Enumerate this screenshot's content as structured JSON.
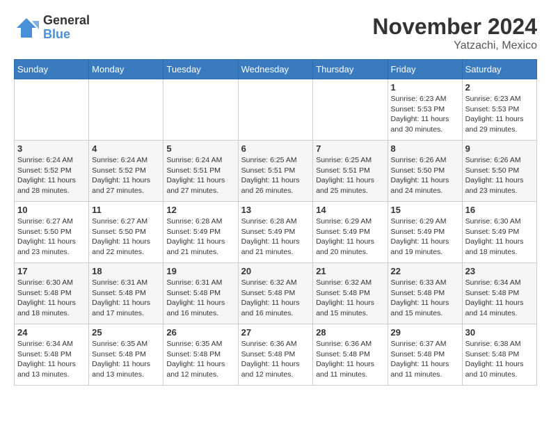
{
  "header": {
    "logo": {
      "general": "General",
      "blue": "Blue"
    },
    "month_title": "November 2024",
    "location": "Yatzachi, Mexico"
  },
  "weekdays": [
    "Sunday",
    "Monday",
    "Tuesday",
    "Wednesday",
    "Thursday",
    "Friday",
    "Saturday"
  ],
  "weeks": [
    [
      {
        "day": "",
        "info": ""
      },
      {
        "day": "",
        "info": ""
      },
      {
        "day": "",
        "info": ""
      },
      {
        "day": "",
        "info": ""
      },
      {
        "day": "",
        "info": ""
      },
      {
        "day": "1",
        "info": "Sunrise: 6:23 AM\nSunset: 5:53 PM\nDaylight: 11 hours and 30 minutes."
      },
      {
        "day": "2",
        "info": "Sunrise: 6:23 AM\nSunset: 5:53 PM\nDaylight: 11 hours and 29 minutes."
      }
    ],
    [
      {
        "day": "3",
        "info": "Sunrise: 6:24 AM\nSunset: 5:52 PM\nDaylight: 11 hours and 28 minutes."
      },
      {
        "day": "4",
        "info": "Sunrise: 6:24 AM\nSunset: 5:52 PM\nDaylight: 11 hours and 27 minutes."
      },
      {
        "day": "5",
        "info": "Sunrise: 6:24 AM\nSunset: 5:51 PM\nDaylight: 11 hours and 27 minutes."
      },
      {
        "day": "6",
        "info": "Sunrise: 6:25 AM\nSunset: 5:51 PM\nDaylight: 11 hours and 26 minutes."
      },
      {
        "day": "7",
        "info": "Sunrise: 6:25 AM\nSunset: 5:51 PM\nDaylight: 11 hours and 25 minutes."
      },
      {
        "day": "8",
        "info": "Sunrise: 6:26 AM\nSunset: 5:50 PM\nDaylight: 11 hours and 24 minutes."
      },
      {
        "day": "9",
        "info": "Sunrise: 6:26 AM\nSunset: 5:50 PM\nDaylight: 11 hours and 23 minutes."
      }
    ],
    [
      {
        "day": "10",
        "info": "Sunrise: 6:27 AM\nSunset: 5:50 PM\nDaylight: 11 hours and 23 minutes."
      },
      {
        "day": "11",
        "info": "Sunrise: 6:27 AM\nSunset: 5:50 PM\nDaylight: 11 hours and 22 minutes."
      },
      {
        "day": "12",
        "info": "Sunrise: 6:28 AM\nSunset: 5:49 PM\nDaylight: 11 hours and 21 minutes."
      },
      {
        "day": "13",
        "info": "Sunrise: 6:28 AM\nSunset: 5:49 PM\nDaylight: 11 hours and 21 minutes."
      },
      {
        "day": "14",
        "info": "Sunrise: 6:29 AM\nSunset: 5:49 PM\nDaylight: 11 hours and 20 minutes."
      },
      {
        "day": "15",
        "info": "Sunrise: 6:29 AM\nSunset: 5:49 PM\nDaylight: 11 hours and 19 minutes."
      },
      {
        "day": "16",
        "info": "Sunrise: 6:30 AM\nSunset: 5:49 PM\nDaylight: 11 hours and 18 minutes."
      }
    ],
    [
      {
        "day": "17",
        "info": "Sunrise: 6:30 AM\nSunset: 5:48 PM\nDaylight: 11 hours and 18 minutes."
      },
      {
        "day": "18",
        "info": "Sunrise: 6:31 AM\nSunset: 5:48 PM\nDaylight: 11 hours and 17 minutes."
      },
      {
        "day": "19",
        "info": "Sunrise: 6:31 AM\nSunset: 5:48 PM\nDaylight: 11 hours and 16 minutes."
      },
      {
        "day": "20",
        "info": "Sunrise: 6:32 AM\nSunset: 5:48 PM\nDaylight: 11 hours and 16 minutes."
      },
      {
        "day": "21",
        "info": "Sunrise: 6:32 AM\nSunset: 5:48 PM\nDaylight: 11 hours and 15 minutes."
      },
      {
        "day": "22",
        "info": "Sunrise: 6:33 AM\nSunset: 5:48 PM\nDaylight: 11 hours and 15 minutes."
      },
      {
        "day": "23",
        "info": "Sunrise: 6:34 AM\nSunset: 5:48 PM\nDaylight: 11 hours and 14 minutes."
      }
    ],
    [
      {
        "day": "24",
        "info": "Sunrise: 6:34 AM\nSunset: 5:48 PM\nDaylight: 11 hours and 13 minutes."
      },
      {
        "day": "25",
        "info": "Sunrise: 6:35 AM\nSunset: 5:48 PM\nDaylight: 11 hours and 13 minutes."
      },
      {
        "day": "26",
        "info": "Sunrise: 6:35 AM\nSunset: 5:48 PM\nDaylight: 11 hours and 12 minutes."
      },
      {
        "day": "27",
        "info": "Sunrise: 6:36 AM\nSunset: 5:48 PM\nDaylight: 11 hours and 12 minutes."
      },
      {
        "day": "28",
        "info": "Sunrise: 6:36 AM\nSunset: 5:48 PM\nDaylight: 11 hours and 11 minutes."
      },
      {
        "day": "29",
        "info": "Sunrise: 6:37 AM\nSunset: 5:48 PM\nDaylight: 11 hours and 11 minutes."
      },
      {
        "day": "30",
        "info": "Sunrise: 6:38 AM\nSunset: 5:48 PM\nDaylight: 11 hours and 10 minutes."
      }
    ]
  ]
}
